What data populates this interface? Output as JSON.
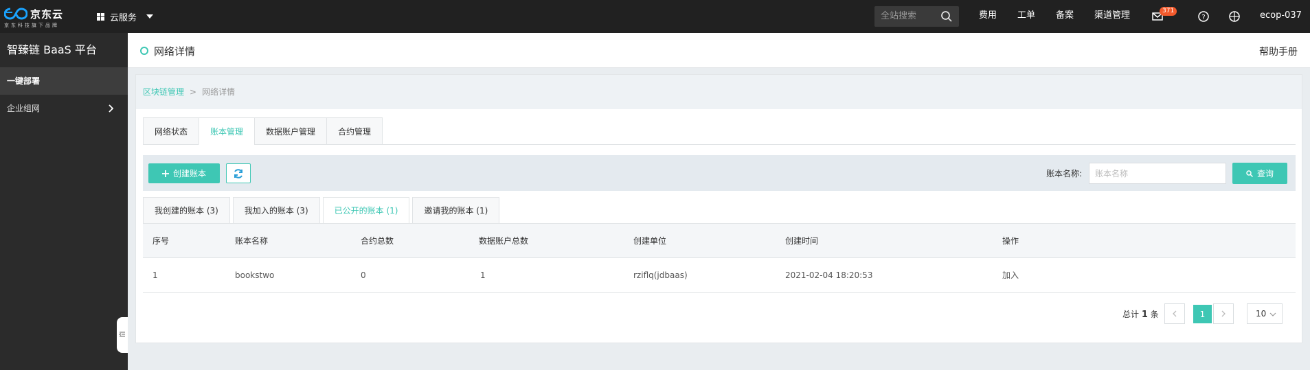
{
  "topbar": {
    "brand": "京东云",
    "tagline": "京东科技旗下品牌",
    "cloud_services": "云服务",
    "search_placeholder": "全站搜索",
    "nav": [
      "费用",
      "工单",
      "备案",
      "渠道管理"
    ],
    "message_count": "371",
    "user": "ecop-037"
  },
  "sidebar": {
    "title": "智臻链 BaaS 平台",
    "items": [
      {
        "label": "一键部署",
        "active": true
      },
      {
        "label": "企业组网",
        "active": false
      }
    ]
  },
  "header": {
    "title": "网络详情",
    "help": "帮助手册"
  },
  "breadcrumb": {
    "parent": "区块链管理",
    "separator": ">",
    "current": "网络详情"
  },
  "tabs": [
    "网络状态",
    "账本管理",
    "数据账户管理",
    "合约管理"
  ],
  "active_tab": "账本管理",
  "toolbar": {
    "create_label": "创建账本",
    "filter_label": "账本名称:",
    "filter_placeholder": "账本名称",
    "query_label": "查询"
  },
  "subtabs": [
    "我创建的账本 (3)",
    "我加入的账本 (3)",
    "已公开的账本 (1)",
    "邀请我的账本 (1)"
  ],
  "active_subtab": "已公开的账本 (1)",
  "table": {
    "headers": [
      "序号",
      "账本名称",
      "合约总数",
      "数据账户总数",
      "创建单位",
      "创建时间",
      "操作"
    ],
    "rows": [
      [
        "1",
        "bookstwo",
        "0",
        "1",
        "rziflq(jdbaas)",
        "2021-02-04 18:20:53",
        "加入"
      ]
    ]
  },
  "pagination": {
    "total_prefix": "总计",
    "total_count": "1",
    "total_suffix": "条",
    "current_page": "1",
    "page_size": "10"
  },
  "colors": {
    "accent": "#3ec7b4",
    "topbar": "#212121",
    "sidebar": "#2b2b2b",
    "badge": "#f35a2c"
  }
}
